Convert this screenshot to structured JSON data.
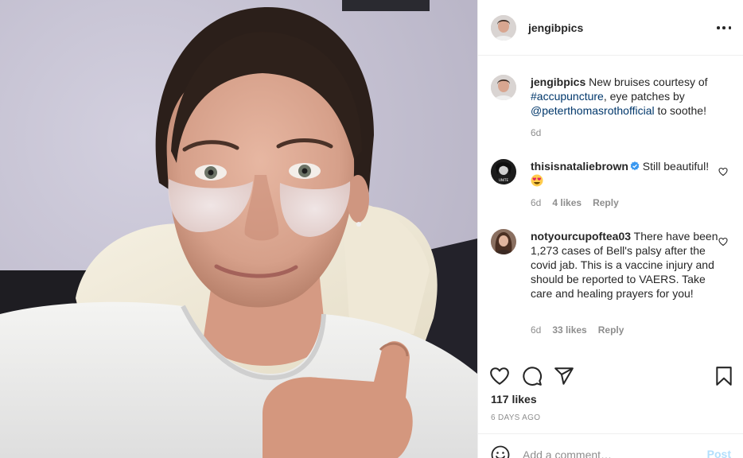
{
  "post": {
    "author": "jengibpics",
    "caption": {
      "username": "jengibpics",
      "text_before": " New bruises courtesy of ",
      "hashtag": "#accupuncture",
      "text_middle": ", eye patches by ",
      "mention": "@peterthomasrothofficial",
      "text_after": " to soothe!",
      "time": "6d"
    },
    "comments": [
      {
        "username": "thisisnataliebrown",
        "verified": true,
        "text": " Still beautiful!",
        "emoji": "heart-eyes-emoji",
        "time": "6d",
        "likes": "4 likes",
        "reply": "Reply"
      },
      {
        "username": "notyourcupoftea03",
        "verified": false,
        "text": " There have been 1,273 cases of Bell's palsy after the covid jab. This is a vaccine injury and should be reported to VAERS. Take care and healing prayers for you!",
        "time": "6d",
        "likes": "33 likes",
        "reply": "Reply"
      }
    ],
    "likes": "117 likes",
    "date": "6 DAYS AGO",
    "add_comment": {
      "placeholder": "Add a comment…",
      "post_label": "Post"
    },
    "icons": [
      "more-icon",
      "heart-icon",
      "comment-icon",
      "share-icon",
      "bookmark-icon",
      "emoji-icon",
      "verified-icon"
    ],
    "colors": {
      "text": "#262626",
      "secondary": "#8e8e8e",
      "link": "#00376b",
      "verified": "#3897f0",
      "post_disabled": "#b2dffc",
      "divider": "#efefef"
    }
  }
}
